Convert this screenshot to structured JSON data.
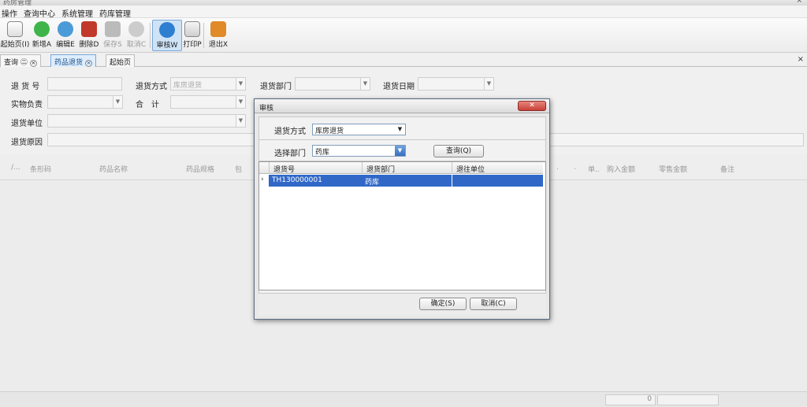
{
  "window": {
    "title": "药房管理",
    "close": "×"
  },
  "menu": [
    "操作",
    "查询中心",
    "系统管理",
    "药库管理"
  ],
  "toolbar": [
    {
      "label": "起始页(I)",
      "icon": "home-icon"
    },
    {
      "label": "新增A",
      "icon": "add-icon"
    },
    {
      "label": "编辑E",
      "icon": "edit-icon"
    },
    {
      "label": "删除D",
      "icon": "delete-icon"
    },
    {
      "label": "保存S",
      "icon": "save-icon"
    },
    {
      "label": "取消C",
      "icon": "undo-icon"
    },
    {
      "label": "审核W",
      "icon": "audit-icon"
    },
    {
      "label": "打印P",
      "icon": "print-icon"
    },
    {
      "label": "退出X",
      "icon": "exit-icon"
    }
  ],
  "tabs": [
    {
      "label": "查询 ㊁"
    },
    {
      "label": "药品退货"
    },
    {
      "label": "起始页"
    }
  ],
  "form": {
    "return_no": "退 货 号",
    "return_method": "退货方式",
    "return_method_value": "库房退货",
    "return_dept": "退货部门",
    "return_date": "退货日期",
    "receiver": "实物负责",
    "total": "合　计",
    "supplier": "退货单位",
    "reason": "退货原因"
  },
  "grid_headers": [
    "/...",
    "条形码",
    "药品名称",
    "药品规格",
    "包",
    ".",
    ".",
    "单..",
    "购入金额",
    "零售金额",
    "备注"
  ],
  "status": {
    "value1": "0",
    "value2": ""
  },
  "dialog": {
    "title": "审核",
    "close": "✕",
    "method_label": "退货方式",
    "method_value": "库房退货",
    "dept_label": "选择部门",
    "dept_value": "药库",
    "query_btn": "查询(Q)",
    "columns": [
      "退货号",
      "退货部门",
      "退往单位"
    ],
    "rows": [
      {
        "no": "TH130000001",
        "dept": "药库",
        "target": ""
      }
    ],
    "ok_btn": "确定(S)",
    "cancel_btn": "取消(C)"
  }
}
